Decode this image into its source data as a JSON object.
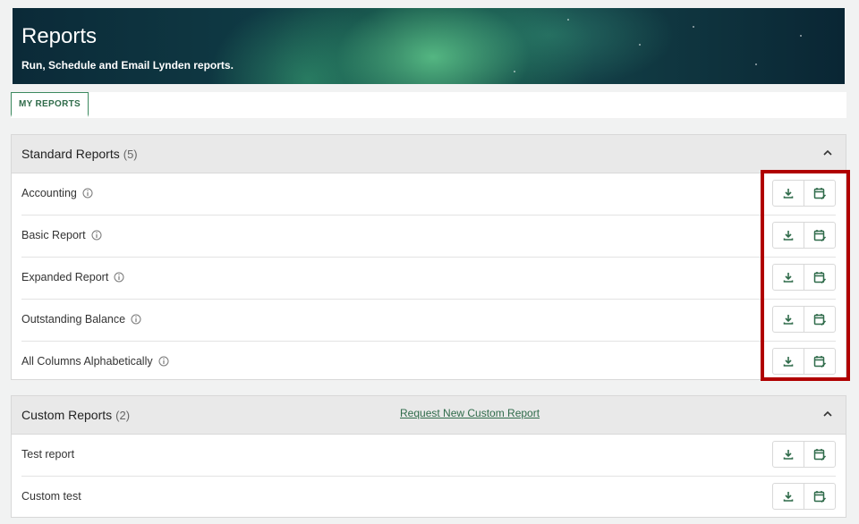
{
  "header": {
    "title": "Reports",
    "subtitle": "Run, Schedule and Email Lynden reports."
  },
  "tabs": [
    {
      "label": "MY REPORTS",
      "active": true
    }
  ],
  "standard_reports": {
    "title": "Standard Reports",
    "count": "(5)",
    "items": [
      {
        "label": "Accounting"
      },
      {
        "label": "Basic Report"
      },
      {
        "label": "Expanded Report"
      },
      {
        "label": "Outstanding Balance"
      },
      {
        "label": "All Columns Alphabetically"
      }
    ]
  },
  "custom_reports": {
    "title": "Custom Reports",
    "count": "(2)",
    "request_link": "Request New Custom Report",
    "items": [
      {
        "label": "Test report"
      },
      {
        "label": "Custom test"
      }
    ]
  },
  "icons": {
    "download": "download-icon",
    "schedule": "calendar-schedule-icon",
    "info": "info-icon",
    "collapse": "chevron-up-icon"
  },
  "colors": {
    "accent_green": "#2f6b4a",
    "highlight_red": "#b00000"
  }
}
